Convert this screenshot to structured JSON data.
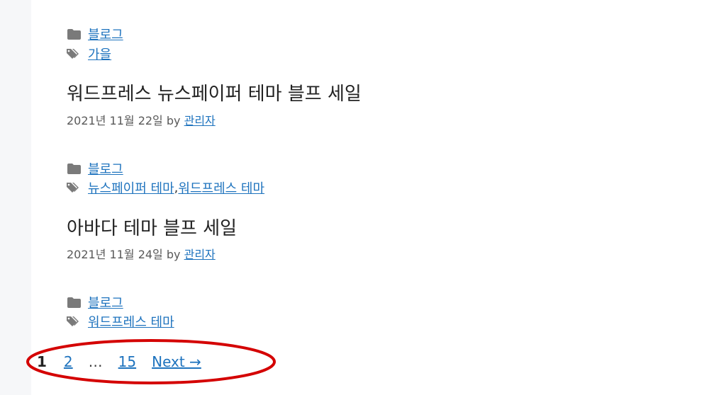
{
  "posts_top": {
    "category": "블로그",
    "tag": "가을"
  },
  "post1": {
    "title": "워드프레스 뉴스페이퍼 테마 블프 세일",
    "date": "2021년 11월 22일",
    "by": "by",
    "author": "관리자",
    "category": "블로그",
    "tags": [
      "뉴스페이퍼 테마",
      "워드프레스 테마"
    ],
    "tag_sep": ", "
  },
  "post2": {
    "title": "아바다 테마 블프 세일",
    "date": "2021년 11월 24일",
    "by": "by",
    "author": "관리자",
    "category": "블로그",
    "tag": "워드프레스 테마"
  },
  "pagination": {
    "current": "1",
    "page2": "2",
    "dots": "…",
    "last": "15",
    "next": "Next →"
  },
  "colors": {
    "link": "#1e73be",
    "highlight": "#d40000",
    "icon": "#7a7a7a"
  },
  "icons": {
    "category": "folder-icon",
    "tag": "tags-icon"
  }
}
